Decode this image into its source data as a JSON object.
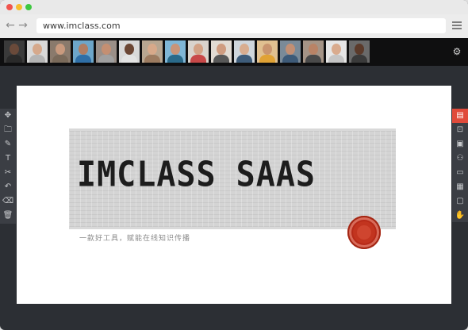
{
  "browser": {
    "url": "www.imclass.com",
    "icons": {
      "back": "arrow-left-icon",
      "forward": "arrow-right-icon",
      "menu": "hamburger-menu-icon"
    }
  },
  "video_strip": {
    "participants": [
      {
        "skin": "#6a4a3a",
        "shirt": "#2a2a2a",
        "bg": "#3a3a3a"
      },
      {
        "skin": "#d6a98c",
        "shirt": "#b5b5b5",
        "bg": "#d8d8d8"
      },
      {
        "skin": "#c99a7e",
        "shirt": "#7a6a5a",
        "bg": "#8a7a6c"
      },
      {
        "skin": "#b07d62",
        "shirt": "#2f6fa7",
        "bg": "#6da6c9"
      },
      {
        "skin": "#c48f72",
        "shirt": "#a0a0a0",
        "bg": "#9a8f88"
      },
      {
        "skin": "#6b4634",
        "shirt": "#e3e3e3",
        "bg": "#d9d9d9"
      },
      {
        "skin": "#d7a98a",
        "shirt": "#9c7b60",
        "bg": "#b7a691"
      },
      {
        "skin": "#c99478",
        "shirt": "#2a6a8a",
        "bg": "#7fb6d6"
      },
      {
        "skin": "#d3a285",
        "shirt": "#c84848",
        "bg": "#d9d3cc"
      },
      {
        "skin": "#cf9c80",
        "shirt": "#585858",
        "bg": "#e2dbd3"
      },
      {
        "skin": "#d8ad90",
        "shirt": "#3e5c7a",
        "bg": "#cfd6dc"
      },
      {
        "skin": "#c9956f",
        "shirt": "#e0a235",
        "bg": "#e0c090"
      },
      {
        "skin": "#c28f74",
        "shirt": "#3d5a78",
        "bg": "#7a8a98"
      },
      {
        "skin": "#b98366",
        "shirt": "#4a4a4a",
        "bg": "#a59486"
      },
      {
        "skin": "#d9ab8e",
        "shirt": "#c5c5c5",
        "bg": "#e6e6e6"
      },
      {
        "skin": "#5b3a2a",
        "shirt": "#3a3a3a",
        "bg": "#6a6a6a"
      }
    ],
    "settings_icon": "gear-icon"
  },
  "left_tools": [
    {
      "name": "move-icon",
      "glyph": "✥"
    },
    {
      "name": "folder-icon",
      "glyph": "🗀"
    },
    {
      "name": "pen-icon",
      "glyph": "✎"
    },
    {
      "name": "text-icon",
      "glyph": "T"
    },
    {
      "name": "scissors-icon",
      "glyph": "✂"
    },
    {
      "name": "undo-icon",
      "glyph": "↶"
    },
    {
      "name": "eraser-icon",
      "glyph": "⌫"
    },
    {
      "name": "trash-icon",
      "glyph": "🗑"
    }
  ],
  "right_tools": [
    {
      "name": "document-icon",
      "glyph": "▤",
      "active": true
    },
    {
      "name": "chat-icon",
      "glyph": "⊡"
    },
    {
      "name": "monitor-icon",
      "glyph": "▣"
    },
    {
      "name": "group-icon",
      "glyph": "⚇"
    },
    {
      "name": "screen-share-icon",
      "glyph": "▭"
    },
    {
      "name": "layout-icon",
      "glyph": "▦"
    },
    {
      "name": "comments-icon",
      "glyph": "▢"
    },
    {
      "name": "hand-raise-icon",
      "glyph": "✋"
    }
  ],
  "slide": {
    "title": "IMCLASS SAAS",
    "subtitle": "一款好工具，赋能在线知识传播",
    "seal_color": "#c2341f"
  }
}
